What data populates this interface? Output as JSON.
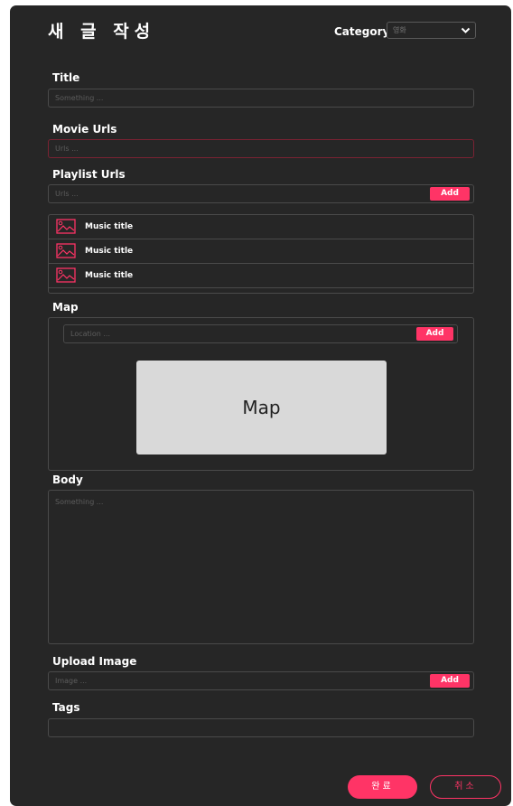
{
  "header": {
    "title": "새 글 작성",
    "category_label": "Category :",
    "category_value": "영화"
  },
  "title_field": {
    "label": "Title",
    "placeholder": "Something ..."
  },
  "movie_urls": {
    "label": "Movie Urls",
    "placeholder": "Urls ..."
  },
  "playlist": {
    "label": "Playlist Urls",
    "placeholder": "Urls ...",
    "add_label": "Add",
    "items": [
      {
        "title": "Music title",
        "icon": "image-icon"
      },
      {
        "title": "Music title",
        "icon": "image-icon"
      },
      {
        "title": "Music title",
        "icon": "image-icon"
      }
    ]
  },
  "map": {
    "label": "Map",
    "placeholder": "Location ...",
    "add_label": "Add",
    "canvas_label": "Map"
  },
  "body": {
    "label": "Body",
    "placeholder": "Something ..."
  },
  "upload": {
    "label": "Upload Image",
    "placeholder": "Image ...",
    "add_label": "Add"
  },
  "tags": {
    "label": "Tags",
    "placeholder": ""
  },
  "actions": {
    "done_label": "완료",
    "cancel_label": "취소"
  },
  "colors": {
    "accent": "#ff3466",
    "panel": "#262626",
    "border": "#4a4a4a",
    "invalid_border": "#7a2233"
  }
}
